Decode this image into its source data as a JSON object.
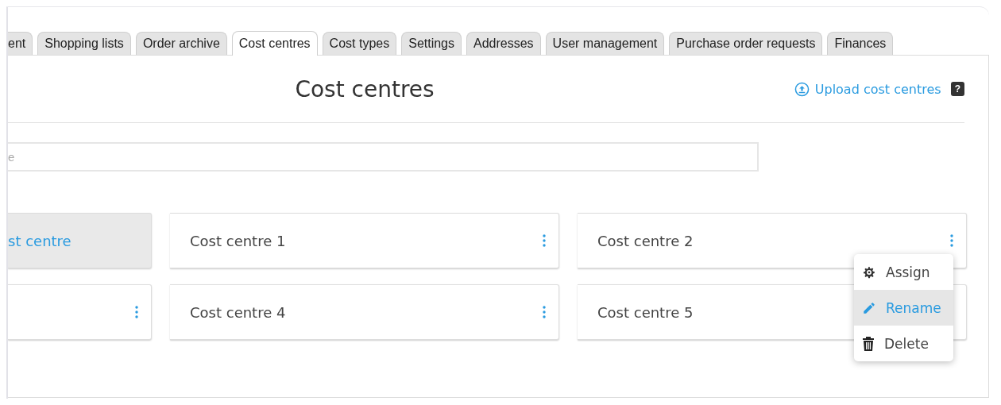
{
  "tabs": [
    {
      "label": "ent",
      "selected": false
    },
    {
      "label": "Shopping lists",
      "selected": false
    },
    {
      "label": "Order archive",
      "selected": false
    },
    {
      "label": "Cost centres",
      "selected": true
    },
    {
      "label": "Cost types",
      "selected": false
    },
    {
      "label": "Settings",
      "selected": false
    },
    {
      "label": "Addresses",
      "selected": false
    },
    {
      "label": "User management",
      "selected": false
    },
    {
      "label": "Purchase order requests",
      "selected": false
    },
    {
      "label": "Finances",
      "selected": false
    }
  ],
  "title": "Cost centres",
  "upload_link": "Upload cost centres",
  "help": "?",
  "search": {
    "placeholder": "e"
  },
  "cards": [
    {
      "kind": "add",
      "label": "st centre",
      "menu_button": false
    },
    {
      "kind": "item",
      "label": "Cost centre 1",
      "menu_button": true
    },
    {
      "kind": "item",
      "label": "Cost centre 2",
      "menu_button": true
    },
    {
      "kind": "item",
      "menu_button": true
    },
    {
      "kind": "item",
      "label": "Cost centre 4",
      "menu_button": true
    },
    {
      "kind": "item",
      "label": "Cost centre 5",
      "menu_button": false
    }
  ],
  "menu": [
    {
      "kind": "gear",
      "label": "Assign",
      "selected": false
    },
    {
      "kind": "pencil",
      "label": "Rename",
      "selected": true
    },
    {
      "kind": "trash",
      "label": "Delete",
      "selected": false
    }
  ]
}
